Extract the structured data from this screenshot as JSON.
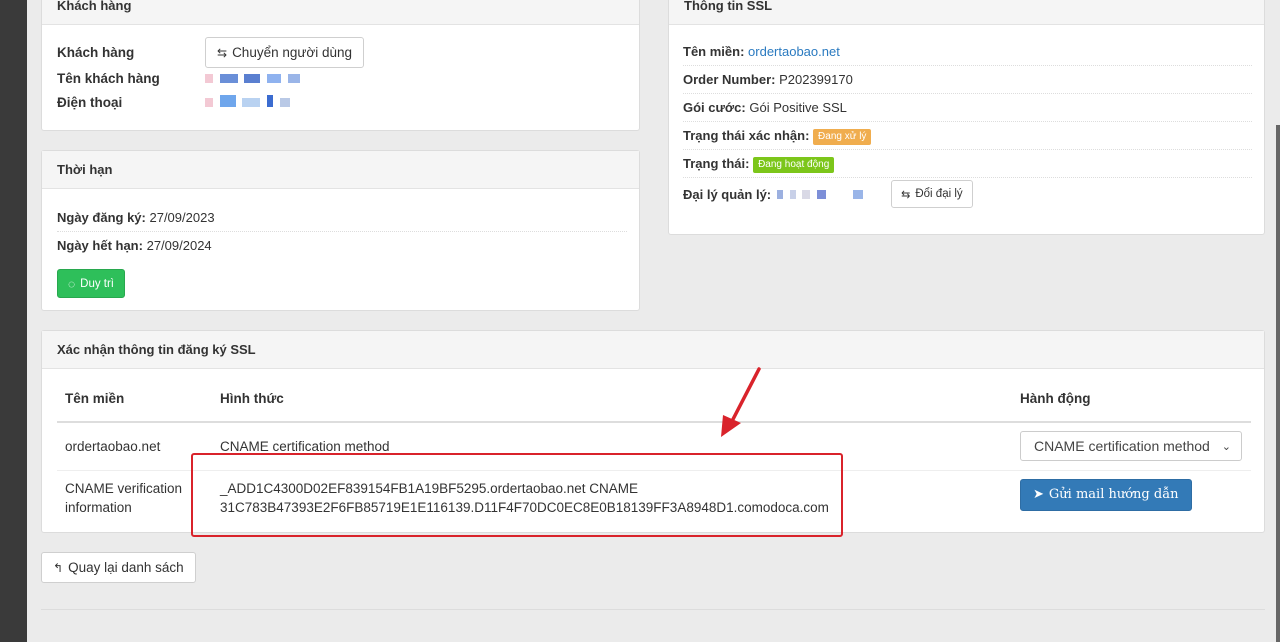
{
  "customer": {
    "heading": "Khách hàng",
    "customer_label": "Khách hàng",
    "switch_user_button": "Chuyển người dùng",
    "customer_name_label": "Tên khách hàng",
    "phone_label": "Điện thoại"
  },
  "term": {
    "heading": "Thời hạn",
    "registered_label": "Ngày đăng ký:",
    "registered_value": "27/09/2023",
    "expiry_label": "Ngày hết hạn:",
    "expiry_value": "27/09/2024",
    "renew_button": "Duy trì"
  },
  "ssl": {
    "heading": "Thông tin SSL",
    "domain_label": "Tên miền:",
    "domain_value": "ordertaobao.net",
    "order_label": "Order Number:",
    "order_value": "P202399170",
    "plan_label": "Gói cước:",
    "plan_value": "Gói Positive SSL",
    "verify_status_label": "Trạng thái xác nhận:",
    "verify_status_badge": "Đang xử lý",
    "status_label": "Trạng thái:",
    "status_badge": "Đang hoạt động",
    "agent_label": "Đại lý quản lý:",
    "change_agent_button": "Đổi đại lý"
  },
  "verify": {
    "heading": "Xác nhận thông tin đăng ký SSL",
    "col_domain": "Tên miền",
    "col_method": "Hình thức",
    "col_action": "Hành động",
    "row1_domain": "ordertaobao.net",
    "row1_method": "CNAME certification method",
    "select_value": "CNAME certification method",
    "row2_label_line1": "CNAME verification",
    "row2_label_line2": "information",
    "cname_line1": "_ADD1C4300D02EF839154FB1A19BF5295.ordertaobao.net CNAME",
    "cname_line2": "31C783B47393E2F6FB85719E1E116139.D11F4F70DC0EC8E0B18139FF3A8948D1.comodoca.com",
    "send_mail_button": "Gửi mail hướng dẫn"
  },
  "back_button": "Quay lại danh sách",
  "colors": {
    "warning_badge": "#f0ad4e",
    "success_badge": "#7cc61a",
    "renew_button": "#2ebf5a",
    "primary_button": "#337ab7",
    "link": "#2a7ac0",
    "annotation_red": "#d9232b"
  }
}
